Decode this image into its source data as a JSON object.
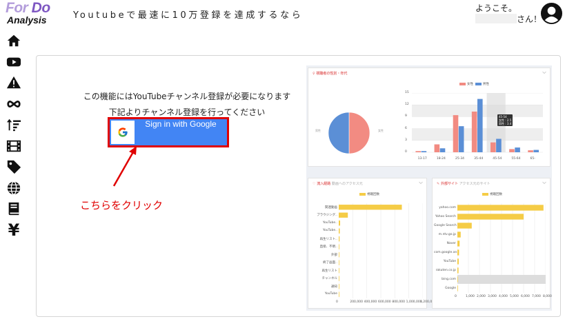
{
  "header": {
    "logo_top_for": "For",
    "logo_top_do": "Do",
    "logo_bottom": "Analysis",
    "tagline": "Youtubeで最速に10万登録を達成するなら",
    "greeting_line1": "ようこそ。",
    "greeting_line2": "さん！",
    "avatar_icon": "user-circle-icon"
  },
  "sidebar": {
    "items": [
      {
        "icon": "home-icon"
      },
      {
        "icon": "youtube-icon"
      },
      {
        "icon": "warning-icon"
      },
      {
        "icon": "infinity-icon"
      },
      {
        "icon": "sort-icon"
      },
      {
        "icon": "film-icon"
      },
      {
        "icon": "tag-icon"
      },
      {
        "icon": "globe-icon"
      },
      {
        "icon": "book-icon"
      },
      {
        "icon": "yen-icon",
        "label": "¥"
      }
    ]
  },
  "main": {
    "requirement_line1": "この機能にはYouTubeチャンネル登録が必要になります",
    "requirement_line2": "下記よりチャンネル登録を行ってください",
    "google_button_label": "Sign in with Google",
    "click_note": "こちらをクリック",
    "colors": {
      "google_blue": "#4285f4",
      "highlight_red": "#e00000"
    }
  },
  "preview": {
    "top_panel_title": "視聴者の性別・年代",
    "pie_label_left": "男性",
    "pie_label_right": "女性",
    "gender_legend": [
      "女性",
      "男性"
    ],
    "tooltip_lines": [
      "45-54",
      "女性 : 2.5",
      "男性 : 3.4"
    ],
    "bottom_left_title": "流入経路",
    "bottom_left_subtitle": "動画へのアクセス元",
    "bottom_right_title": "外部サイト",
    "bottom_right_subtitle": "アクセス元のサイト",
    "views_legend": "視聴回数",
    "colors": {
      "female": "#f28b82",
      "male": "#5b8fd6",
      "bar": "#f5cc46",
      "accent": "#e57373"
    }
  },
  "chart_data": [
    {
      "type": "pie",
      "categories": [
        "女性",
        "男性"
      ],
      "values": [
        50,
        50
      ]
    },
    {
      "type": "bar",
      "categories": [
        "13-17",
        "18-24",
        "25-34",
        "35-44",
        "45-54",
        "55-64",
        "65-"
      ],
      "series": [
        {
          "name": "女性",
          "values": [
            0.3,
            2.0,
            9.4,
            10.3,
            2.5,
            0.8,
            0.5
          ]
        },
        {
          "name": "男性",
          "values": [
            0.3,
            1.0,
            6.6,
            13.5,
            3.4,
            1.2,
            0.6
          ]
        }
      ],
      "grid": true,
      "legend": "top-center"
    },
    {
      "type": "bar",
      "orientation": "horizontal",
      "categories": [
        "関連動画",
        "ブラウジング..",
        "YouTube..",
        "YouTube..",
        "再生リスト..",
        "直接、不明..",
        "外部",
        "終了画面..",
        "再生リスト",
        "チャンネル",
        "通知",
        "YouTube"
      ],
      "values": [
        900000,
        130000,
        20000,
        15000,
        12000,
        8000,
        6000,
        4000,
        3000,
        2000,
        1500,
        1000
      ],
      "xlabels": [
        "0",
        "200,000",
        "400,000",
        "600,000",
        "800,000",
        "1,000,000",
        "1,200,000"
      ],
      "grid": true,
      "legend": "top-center"
    },
    {
      "type": "bar",
      "orientation": "horizontal",
      "categories": [
        "yahoo.com",
        "Yahoo Search",
        "Google Search",
        "m.ntv.go.jp",
        "Naver",
        "com.google.an..",
        "YouTube",
        "rakuten.co.jp",
        "bing.com",
        "Google"
      ],
      "values": [
        7800,
        6000,
        1300,
        300,
        200,
        150,
        120,
        100,
        30,
        20
      ],
      "xlabels": [
        "0",
        "1,000",
        "2,000",
        "3,000",
        "4,000",
        "5,000",
        "6,000",
        "7,000",
        "8,000"
      ],
      "grid": true,
      "legend": "top-center"
    }
  ]
}
